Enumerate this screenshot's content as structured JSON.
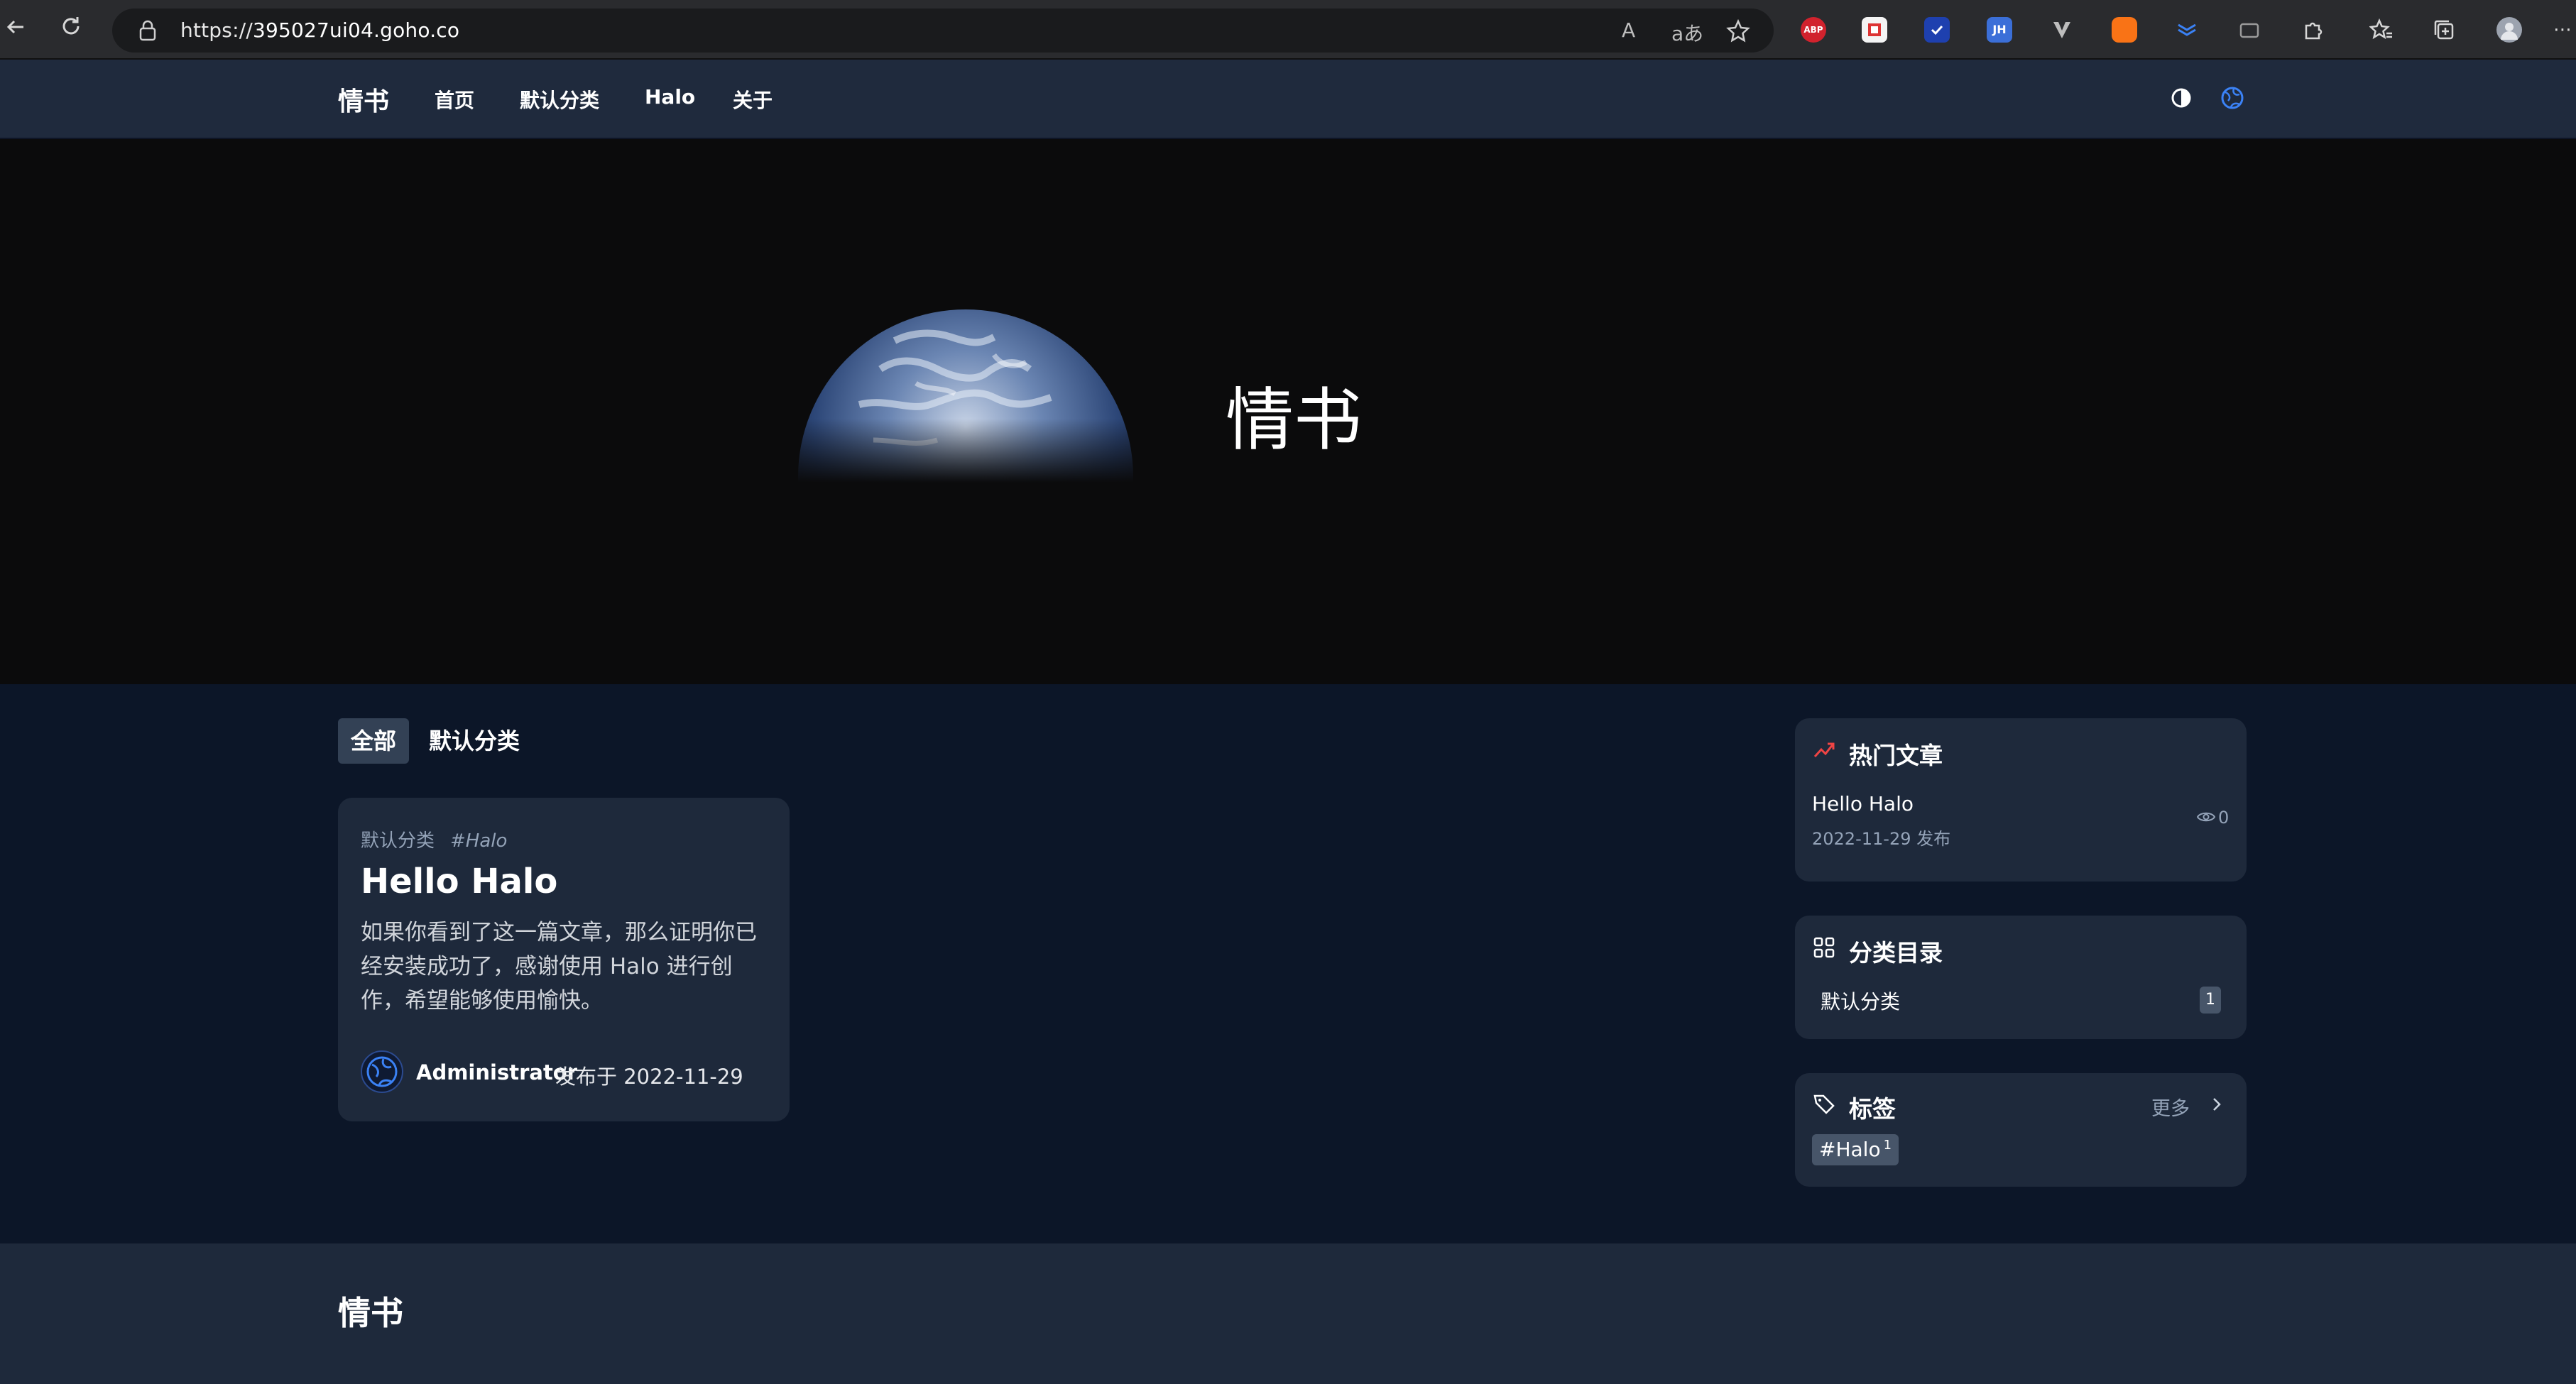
{
  "browser": {
    "url_scheme": "https://",
    "url_host": "395027ui04.goho.co",
    "extensions": [
      "ABP",
      "JH"
    ]
  },
  "site": {
    "brand": "情书",
    "menu": [
      "首页",
      "默认分类",
      "Halo",
      "关于"
    ],
    "colors": {
      "accent": "#3b82f6",
      "card": "#1e293b",
      "body": "#0c1628",
      "header": "#1f2a3d"
    }
  },
  "hero": {
    "title": "情书",
    "image": "earth-icon"
  },
  "tabs": [
    {
      "label": "全部",
      "active": true
    },
    {
      "label": "默认分类",
      "active": false
    }
  ],
  "post": {
    "category": "默认分类",
    "tag": "#Halo",
    "title": "Hello Halo",
    "excerpt": "如果你看到了这一篇文章，那么证明你已经安装成功了，感谢使用 Halo 进行创作，希望能够使用愉快。",
    "author": "Administrator",
    "date_label": "发布于 2022-11-29"
  },
  "sidebar": {
    "hot": {
      "title": "热门文章",
      "items": [
        {
          "title": "Hello Halo",
          "date": "2022-11-29 发布",
          "views": "0"
        }
      ]
    },
    "categories": {
      "title": "分类目录",
      "items": [
        {
          "name": "默认分类",
          "count": "1"
        }
      ]
    },
    "tags": {
      "title": "标签",
      "more": "更多",
      "items": [
        {
          "name": "#Halo",
          "count": "1"
        }
      ]
    }
  },
  "footer": {
    "brand": "情书"
  }
}
